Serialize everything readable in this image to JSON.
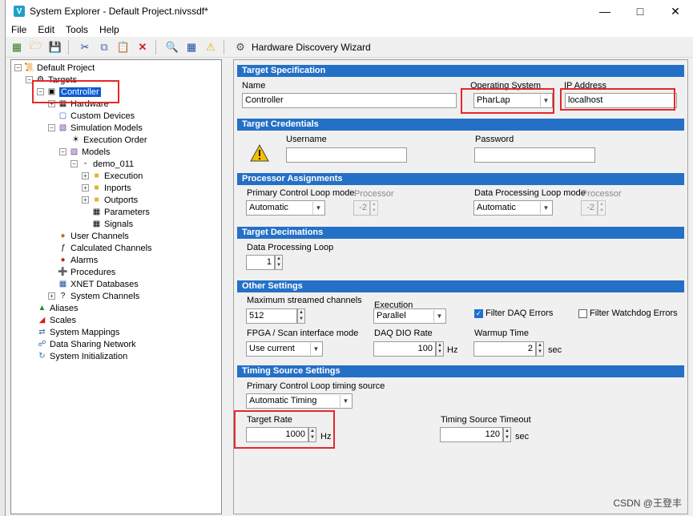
{
  "window": {
    "title": "System Explorer - Default Project.nivssdf*",
    "app_icon": "V"
  },
  "menu": [
    "File",
    "Edit",
    "Tools",
    "Help"
  ],
  "toolbar": {
    "hardware_wizard": "Hardware Discovery Wizard"
  },
  "tree": {
    "default_project": "Default Project",
    "targets": "Targets",
    "controller": "Controller",
    "hardware": "Hardware",
    "custom_devices": "Custom Devices",
    "simulation_models": "Simulation Models",
    "execution_order": "Execution Order",
    "models": "Models",
    "demo": "demo_011",
    "execution": "Execution",
    "inports": "Inports",
    "outports": "Outports",
    "parameters": "Parameters",
    "signals": "Signals",
    "user_channels": "User Channels",
    "calculated_channels": "Calculated Channels",
    "alarms": "Alarms",
    "procedures": "Procedures",
    "xnet": "XNET Databases",
    "system_channels": "System Channels",
    "aliases": "Aliases",
    "scales": "Scales",
    "system_mappings": "System Mappings",
    "data_sharing": "Data Sharing Network",
    "system_init": "System Initialization"
  },
  "target_spec": {
    "header": "Target Specification",
    "name_label": "Name",
    "name_value": "Controller",
    "os_label": "Operating System",
    "os_value": "PharLap",
    "ip_label": "IP Address",
    "ip_value": "localhost"
  },
  "credentials": {
    "header": "Target Credentials",
    "username_label": "Username",
    "password_label": "Password"
  },
  "processor": {
    "header": "Processor Assignments",
    "pcl_label": "Primary Control Loop mode",
    "pcl_value": "Automatic",
    "proc_label": "Processor",
    "proc_value": "-2",
    "dpl_label": "Data Processing Loop mode",
    "dpl_value": "Automatic",
    "proc2_value": "-2"
  },
  "decimations": {
    "header": "Target Decimations",
    "dpl_label": "Data Processing Loop",
    "dpl_value": "1"
  },
  "other": {
    "header": "Other Settings",
    "max_label": "Maximum streamed channels",
    "max_value": "512",
    "exec_label": "Execution",
    "exec_value": "Parallel",
    "filter_daq": "Filter DAQ Errors",
    "filter_watchdog": "Filter Watchdog Errors",
    "fpga_label": "FPGA / Scan interface mode",
    "fpga_value": "Use current",
    "daq_rate_label": "DAQ DIO Rate",
    "daq_rate_value": "100",
    "hz": "Hz",
    "warmup_label": "Warmup Time",
    "warmup_value": "2",
    "sec": "sec"
  },
  "timing": {
    "header": "Timing Source Settings",
    "source_label": "Primary Control Loop timing source",
    "source_value": "Automatic Timing",
    "rate_label": "Target Rate",
    "rate_value": "1000",
    "hz": "Hz",
    "timeout_label": "Timing Source Timeout",
    "timeout_value": "120",
    "sec": "sec"
  },
  "watermark": "CSDN @王登丰",
  "colors": {
    "section_header": "#2470c6",
    "selection": "#0a5bd3",
    "highlight": "#e5282b"
  }
}
